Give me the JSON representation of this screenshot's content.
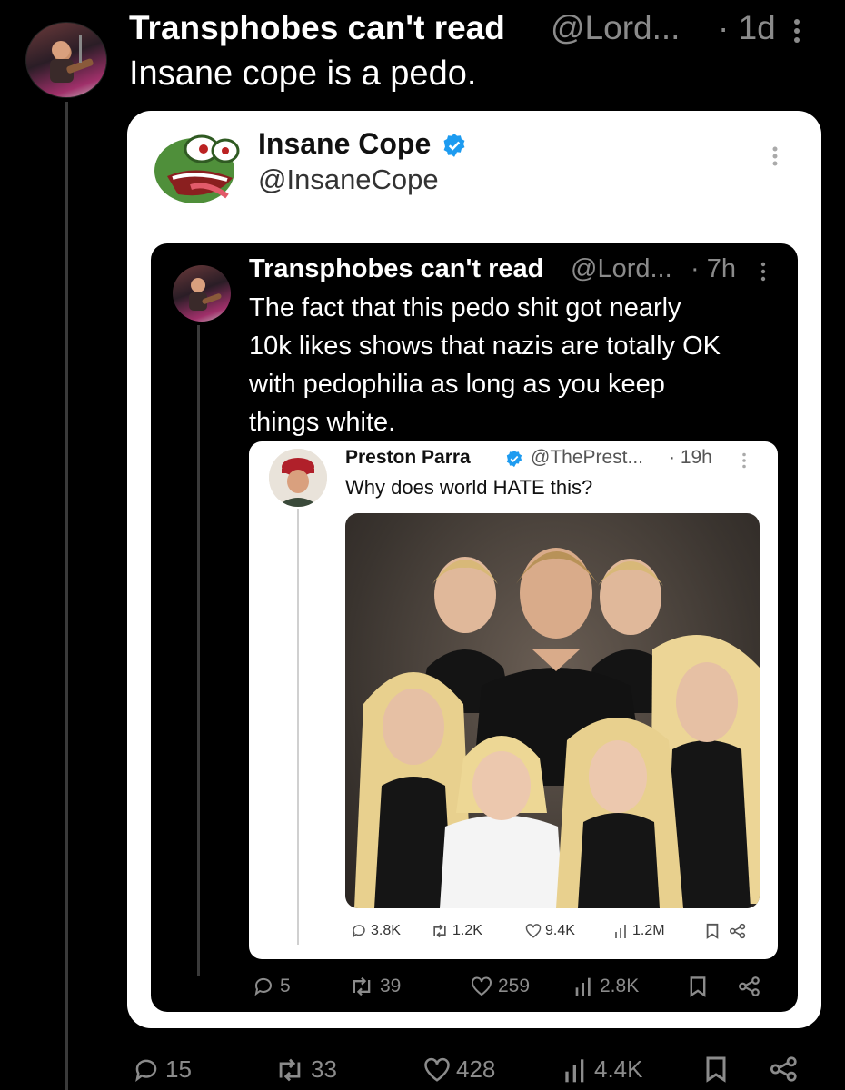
{
  "outer_tweet": {
    "name": "Transphobes can't read",
    "handle": "@Lord...",
    "time": "· 1d",
    "text": "Insane cope is a pedo.",
    "stats": {
      "replies": "15",
      "retweets": "33",
      "likes": "428",
      "views": "4.4K"
    }
  },
  "quoted_tweet": {
    "name": "Insane Cope",
    "handle": "@InsaneCope"
  },
  "embedded_tweet": {
    "name": "Transphobes can't read",
    "handle": "@Lord...",
    "time": "· 7h",
    "text_lines": [
      "The fact that this pedo shit got nearly",
      "10k likes shows that nazis are totally OK",
      "with pedophilia as long as you keep",
      "things white."
    ],
    "stats": {
      "replies": "5",
      "retweets": "39",
      "likes": "259",
      "views": "2.8K"
    }
  },
  "inner_tweet": {
    "name": "Preston Parra",
    "handle": "@ThePrest...",
    "time": "· 19h",
    "text": "Why does world HATE this?",
    "stats": {
      "replies": "3.8K",
      "retweets": "1.2K",
      "likes": "9.4K",
      "views": "1.2M"
    }
  },
  "colors": {
    "verified": "#1d9bf0",
    "muted": "#8b8b8b"
  }
}
